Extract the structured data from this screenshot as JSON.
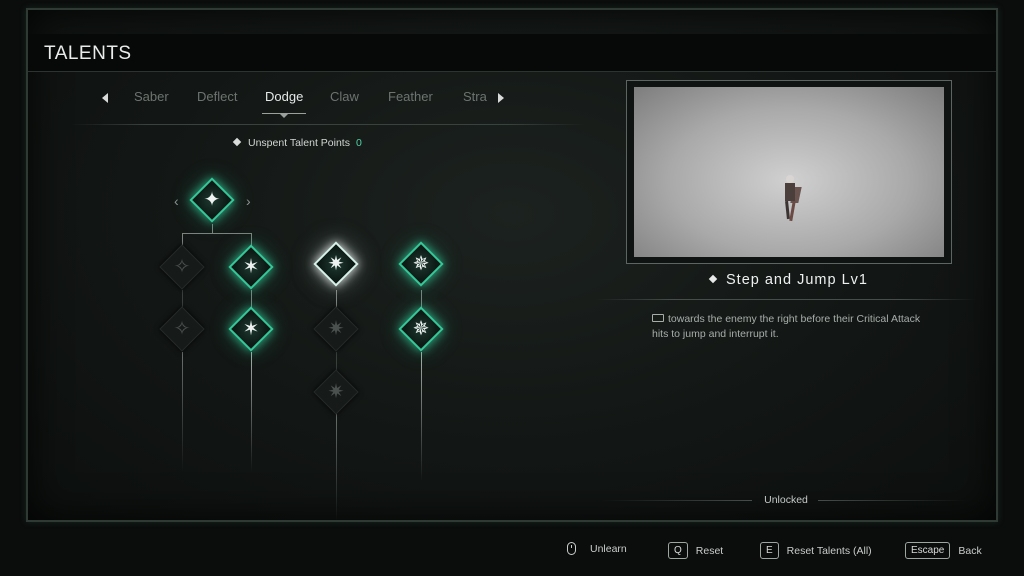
{
  "header": {
    "title": "TALENTS"
  },
  "tabs": {
    "items": [
      "Saber",
      "Deflect",
      "Dodge",
      "Claw",
      "Feather",
      "Stra"
    ],
    "active": "Dodge"
  },
  "points": {
    "label": "Unspent Talent Points",
    "value": "0"
  },
  "skill": {
    "name": "Step and Jump Lv1",
    "description": "towards the enemy the right before their Critical Attack hits to jump and interrupt it.",
    "status": "Unlocked"
  },
  "footer": {
    "unlearn": "Unlearn",
    "reset_key": "Q",
    "reset": "Reset",
    "reset_all_key": "E",
    "reset_all": "Reset Talents (All)",
    "back_key": "Escape",
    "back": "Back"
  },
  "colors": {
    "accent": "#35c99a",
    "points_value": "#4fd3a8",
    "background": "#121614"
  },
  "nodes": [
    {
      "id": "root",
      "state": "unlocked",
      "icon": "dodge-beast-icon"
    },
    {
      "id": "c1r1",
      "state": "locked",
      "icon": "beast-claw-icon"
    },
    {
      "id": "c2r1",
      "state": "unlocked",
      "icon": "leap-icon"
    },
    {
      "id": "c3r1",
      "state": "selected",
      "icon": "step-jump-icon"
    },
    {
      "id": "c4r1",
      "state": "unlocked",
      "icon": "slash-dash-icon"
    },
    {
      "id": "c1r2",
      "state": "locked",
      "icon": "beast-claw-icon"
    },
    {
      "id": "c2r2",
      "state": "unlocked",
      "icon": "leap-icon"
    },
    {
      "id": "c3r2",
      "state": "locked",
      "icon": "step-jump-icon"
    },
    {
      "id": "c4r2",
      "state": "unlocked",
      "icon": "slash-dash-icon"
    },
    {
      "id": "c3r3",
      "state": "locked",
      "icon": "step-jump-icon"
    }
  ]
}
